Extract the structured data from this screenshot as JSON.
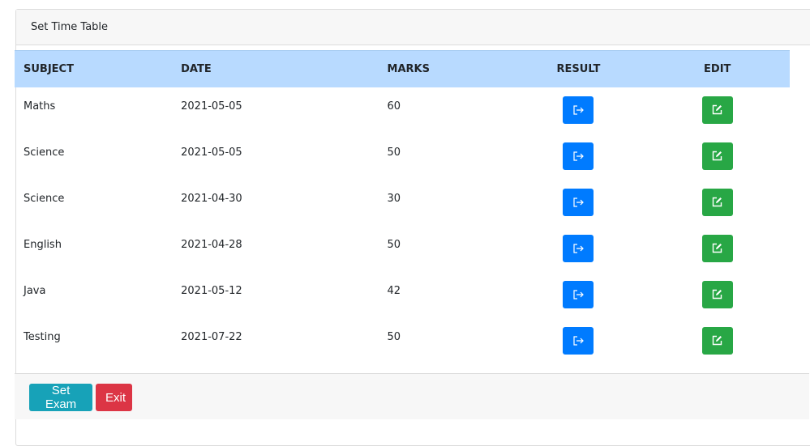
{
  "card": {
    "title": "Set Time Table"
  },
  "table": {
    "headers": {
      "subject": "SUBJECT",
      "date": "DATE",
      "marks": "MARKS",
      "result": "RESULT",
      "edit": "EDIT"
    },
    "header_color": "#b8daff",
    "rows": [
      {
        "subject": "Maths",
        "date": "2021-05-05",
        "marks": "60"
      },
      {
        "subject": "Science",
        "date": "2021-05-05",
        "marks": "50"
      },
      {
        "subject": "Science",
        "date": "2021-04-30",
        "marks": "30"
      },
      {
        "subject": "English",
        "date": "2021-04-28",
        "marks": "50"
      },
      {
        "subject": "Java",
        "date": "2021-05-12",
        "marks": "42"
      },
      {
        "subject": "Testing",
        "date": "2021-07-22",
        "marks": "50"
      }
    ],
    "result_button": {
      "icon": "sign-out-icon",
      "color": "#007bff"
    },
    "edit_button": {
      "icon": "edit-icon",
      "color": "#28a745"
    }
  },
  "footer": {
    "set_exam_label": "Set Exam",
    "set_exam_color": "#17a2b8",
    "exit_label": "Exit",
    "exit_color": "#dc3545"
  }
}
